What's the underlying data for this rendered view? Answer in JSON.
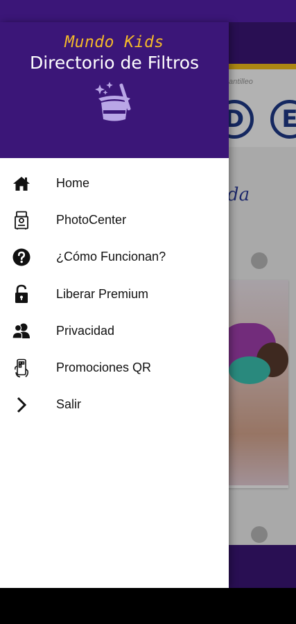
{
  "colors": {
    "primary": "#3b1678",
    "accent": "#f4b92a",
    "background_heading": "#2a3a9a",
    "drawer_background": "#ffffff",
    "menu_text": "#111111"
  },
  "drawer": {
    "title": "Mundo Kids",
    "subtitle": "Directorio de Filtros",
    "header_icon": "magic-hat-icon",
    "items": [
      {
        "label": "Home",
        "icon": "home-icon"
      },
      {
        "label": "PhotoCenter",
        "icon": "photo-kiosk-icon"
      },
      {
        "label": "¿Cómo Funcionan?",
        "icon": "help-circle-icon"
      },
      {
        "label": "Liberar Premium",
        "icon": "unlock-icon"
      },
      {
        "label": "Privacidad",
        "icon": "users-icon"
      },
      {
        "label": "Promociones QR",
        "icon": "phone-qr-icon"
      },
      {
        "label": "Salir",
        "icon": "chevron-right-icon"
      }
    ]
  },
  "background": {
    "strip_label": "antilleo",
    "circle_letters": [
      "D",
      "E"
    ],
    "heading_fragment": "rada"
  }
}
